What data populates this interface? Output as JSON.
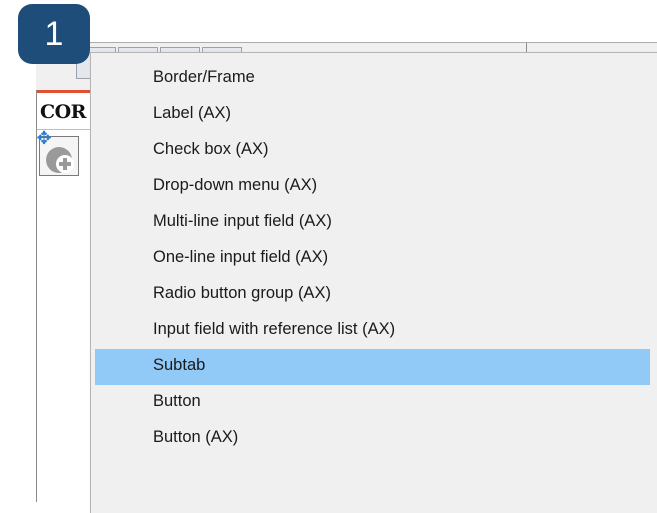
{
  "badge": {
    "number": "1"
  },
  "panel": {
    "tab_label": "COR"
  },
  "context_menu": {
    "items": [
      {
        "label": "Border/Frame",
        "highlighted": false
      },
      {
        "label": "Label (AX)",
        "highlighted": false
      },
      {
        "label": "Check box (AX)",
        "highlighted": false
      },
      {
        "label": "Drop-down menu (AX)",
        "highlighted": false
      },
      {
        "label": "Multi-line input field (AX)",
        "highlighted": false
      },
      {
        "label": "One-line input field (AX)",
        "highlighted": false
      },
      {
        "label": "Radio button group (AX)",
        "highlighted": false
      },
      {
        "label": "Input field with reference list (AX)",
        "highlighted": false
      },
      {
        "label": "Subtab",
        "highlighted": true
      },
      {
        "label": "Button",
        "highlighted": false
      },
      {
        "label": "Button (AX)",
        "highlighted": false
      }
    ]
  },
  "colors": {
    "highlight": "#91c9f7",
    "badge": "#1f4d7a",
    "tab_accent": "#e0512f",
    "menu_bg": "#f0f0f0"
  },
  "icons": [
    "move-icon",
    "add-control-icon"
  ]
}
